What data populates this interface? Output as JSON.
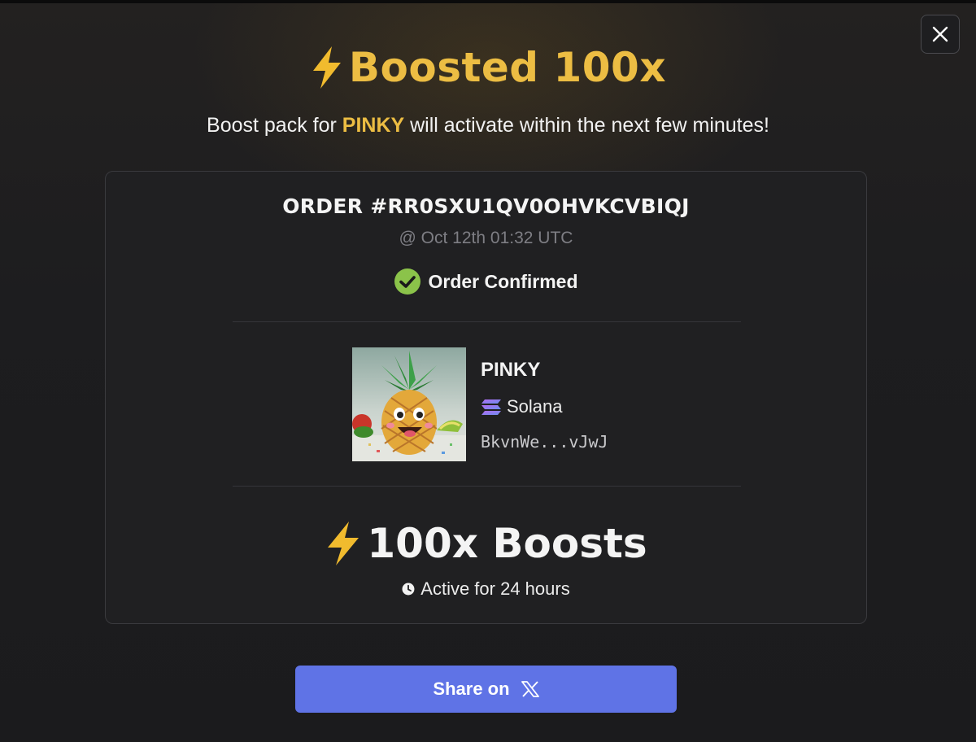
{
  "modal": {
    "title": "Boosted 100x",
    "subtitle_prefix": "Boost pack for ",
    "subtitle_token": "PINKY",
    "subtitle_suffix": " will activate within the next few minutes!",
    "close_icon": "close-icon"
  },
  "order": {
    "id": "ORDER #RR0SXU1QV0OHVKCVBIQJ",
    "time": "@ Oct 12th 01:32 UTC",
    "status": "Order Confirmed",
    "status_color": "#8bc34a"
  },
  "token": {
    "name": "PINKY",
    "chain": "Solana",
    "address": "BkvnWe...vJwJ",
    "image": "pineapple-avatar"
  },
  "boost": {
    "amount": "100x Boosts",
    "duration": "Active for 24 hours"
  },
  "share": {
    "label": "Share on",
    "icon": "x-logo-icon"
  },
  "colors": {
    "accent": "#ecbd43",
    "button": "#5f73e6",
    "background": "#1c1c1e",
    "card": "#202022"
  }
}
